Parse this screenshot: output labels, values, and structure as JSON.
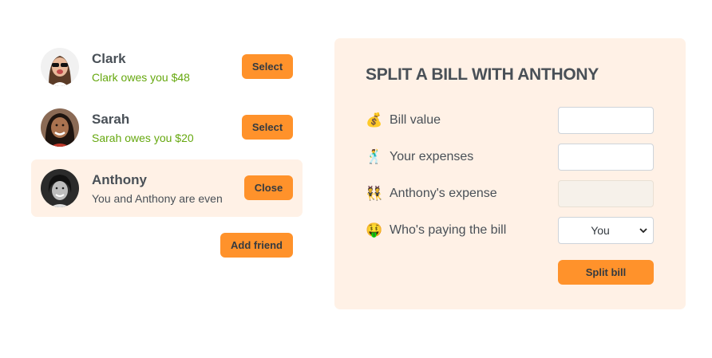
{
  "friends": [
    {
      "name": "Clark",
      "status": "Clark owes you $48",
      "button": "Select"
    },
    {
      "name": "Sarah",
      "status": "Sarah owes you $20",
      "button": "Select"
    },
    {
      "name": "Anthony",
      "status": "You and Anthony are even",
      "button": "Close"
    }
  ],
  "add_friend_label": "Add friend",
  "split_form": {
    "title": "Split a bill with Anthony",
    "bill_value": {
      "emoji": "💰",
      "label": "Bill value",
      "value": ""
    },
    "your_expense": {
      "emoji": "🕺",
      "label": "Your expenses",
      "value": ""
    },
    "friend_expense": {
      "emoji": "👯",
      "label": "Anthony's expense",
      "value": ""
    },
    "payer": {
      "emoji": "🤑",
      "label": "Who's paying the bill",
      "selected": "You"
    },
    "submit_label": "Split bill"
  },
  "colors": {
    "accent": "#ff922b",
    "panel_bg": "#fff1e6",
    "positive": "#66a80f",
    "text": "#495057"
  }
}
